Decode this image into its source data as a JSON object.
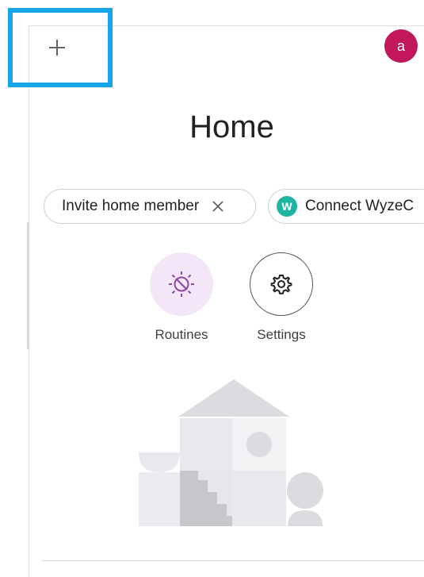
{
  "header": {
    "add_icon": "plus-icon",
    "avatar_initial": "a",
    "avatar_color": "#c2185b",
    "highlight_color": "#19a6e6"
  },
  "page": {
    "title": "Home"
  },
  "chips": {
    "invite_label": "Invite home member",
    "invite_close_icon": "close-icon",
    "connect_label": "Connect WyzeC",
    "connect_logo_letter": "W",
    "connect_logo_color": "#1fb5a3"
  },
  "actions": {
    "routines_label": "Routines",
    "routines_icon": "routines-icon",
    "settings_label": "Settings",
    "settings_icon": "gear-icon"
  }
}
